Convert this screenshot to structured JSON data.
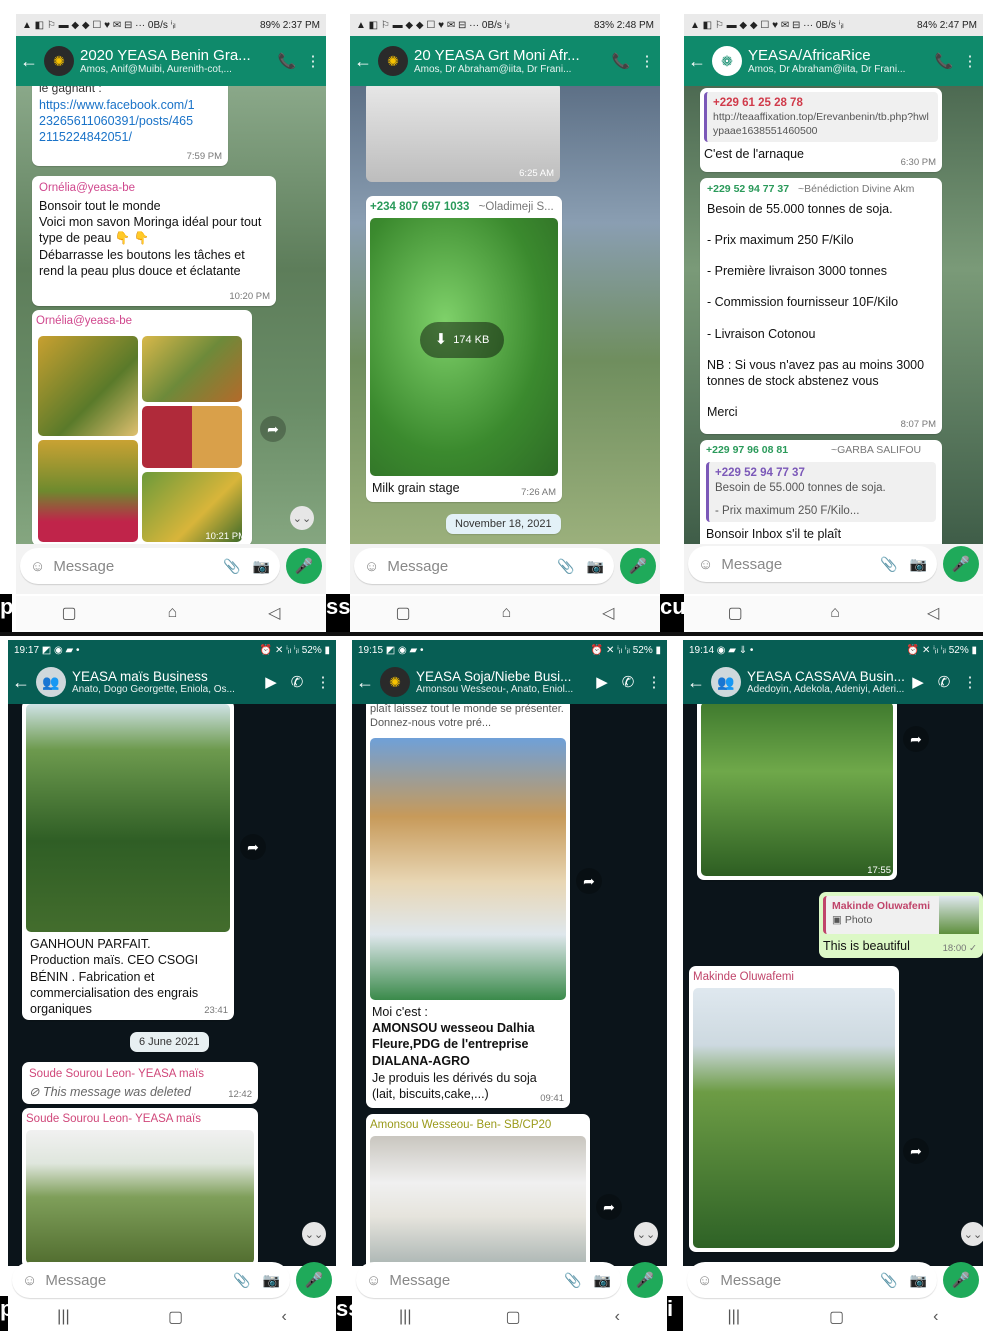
{
  "panel1": {
    "status": {
      "left": "▲ ◧ ⚐ ▬ ◆ ◆ ☐ ♥ ✉ ⊟ ···  0B/s ⁱᵢₗ",
      "right": "89% 2:37 PM"
    },
    "title": "2020 YEASA Benin Gra...",
    "subtitle": "Amos, Anif@Muibi, Aurenith-cot,...",
    "cut_text": "le gagnant :",
    "link": "https://www.facebook.com/123265611060391/posts/4652115224842051/",
    "link_time": "7:59 PM",
    "msg1_sender": "Ornélia@yeasa-be",
    "msg1_text": "Bonsoir tout le monde\nVoici mon savon Moringa idéal pour tout type de peau 👇 👇\nDébarrasse les boutons les tâches et rend la peau plus douce et éclatante",
    "msg1_time": "10:20 PM",
    "msg2_sender": "Ornélia@yeasa-be",
    "msg2_time": "10:21 PM",
    "input_placeholder": "Message"
  },
  "panel2": {
    "status": {
      "left": "▲ ◧ ⚐ ▬ ◆ ◆ ☐ ♥ ✉ ⊟ ···  0B/s ⁱᵢₗ",
      "right": "83% 2:48 PM"
    },
    "title": "20 YEASA Grt Moni Afr...",
    "subtitle": "Amos, Dr Abraham@iita, Dr Frani...",
    "img1_time": "6:25 AM",
    "msg_phone": "+234 807 697 1033",
    "msg_name": "~Oladimeji S...",
    "download": "174 KB",
    "caption": "Milk grain stage",
    "caption_time": "7:26 AM",
    "date_pill": "November 18, 2021",
    "input_placeholder": "Message"
  },
  "panel3": {
    "status": {
      "left": "▲ ◧ ⚐ ▬ ◆ ◆ ☐ ♥ ✉ ⊟ ···  0B/s ⁱᵢₗ",
      "right": "84% 2:47 PM"
    },
    "title": "YEASA/AfricaRice",
    "subtitle": "Amos, Dr Abraham@iita, Dr Frani...",
    "q1_phone": "+229 61 25 28 78",
    "q1_text": "http://teaaffixation.top/Erevanbenin/tb.php?hwlypaae1638551460500",
    "r1_text": "C'est de l'arnaque",
    "r1_time": "6:30 PM",
    "m2_phone": "+229 52 94 77 37",
    "m2_name": "~Bénédiction Divine Akm",
    "m2_lines": [
      "Besoin de 55.000 tonnes de soja.",
      "- Prix maximum 250 F/Kilo",
      "- Première livraison  3000 tonnes",
      "- Commission fournisseur 10F/Kilo",
      "- Livraison Cotonou",
      "NB : Si vous n'avez pas au moins 3000 tonnes de stock abstenez vous",
      "Merci"
    ],
    "m2_time": "8:07 PM",
    "m3_phone": "+229 97 96 08 81",
    "m3_name": "~GARBA SALIFOU",
    "m3_q_phone": "+229 52 94 77 37",
    "m3_q_line1": "Besoin de 55.000 tonnes de soja.",
    "m3_q_line2": "- Prix maximum 250 F/Kilo...",
    "m3_text": "Bonsoir Inbox s'il te plaît",
    "input_placeholder": "Message"
  },
  "panel4": {
    "status": {
      "left": "19:17 ◩ ◉ ▰ •",
      "right": "⏰ ✕ ⁱᵢₗ ⁱᵢₗ 52% ▮"
    },
    "title": "YEASA maïs Business",
    "subtitle": "Anato, Dogo Georgette, Eniola, Os...",
    "caption": "GANHOUN PARFAIT.\nProduction maïs. CEO CSOGI BÉNIN . Fabrication et commercialisation des engrais organiques",
    "caption_time": "23:41",
    "date_pill": "6 June 2021",
    "deleted_sender": "Soude Sourou Leon- YEASA maïs",
    "deleted_text": "This message was deleted",
    "deleted_time": "12:42",
    "img_sender": "Soude Sourou Leon- YEASA maïs",
    "input_placeholder": "Message"
  },
  "panel5": {
    "status": {
      "left": "19:15 ◩ ◉ ▰ •",
      "right": "⏰ ✕ ⁱᵢₗ ⁱᵢₗ 52% ▮"
    },
    "title": "YEASA Soja/Niebe Busi...",
    "subtitle": "Amonsou Wesseou-, Anato, Eniol...",
    "cut_text": "plaît laissez tout le monde se présenter. Donnez-nous votre pré...",
    "intro": "Moi c'est :",
    "intro_bold": "AMONSOU wesseou Dalhia Fleure,PDG de l'entreprise DIALANA-AGRO",
    "intro_rest": "Je produis les dérivés du soja (lait, biscuits,cake,...)",
    "intro_time": "09:41",
    "img_sender": "Amonsou Wesseou- Ben- SB/CP20",
    "input_placeholder": "Message"
  },
  "panel6": {
    "status": {
      "left": "19:14 ◉ ▰ ⇓ •",
      "right": "⏰ ✕ ⁱᵢₗ ⁱᵢₗ 52% ▮"
    },
    "title": "YEASA CASSAVA Busin...",
    "subtitle": "Adedoyin, Adekola, Adeniyi, Aderi...",
    "img1_time": "17:55",
    "reply_sender": "Makinde Oluwafemi",
    "reply_type": "Photo",
    "reply_text": "This is beautiful",
    "reply_time": "18:00 ✓",
    "img2_sender": "Makinde Oluwafemi",
    "input_placeholder": "Message"
  },
  "strips": {
    "s1": "p",
    "s2": "ss",
    "s3": "cu",
    "s4": "p",
    "s5": "ss",
    "s6": "i"
  }
}
